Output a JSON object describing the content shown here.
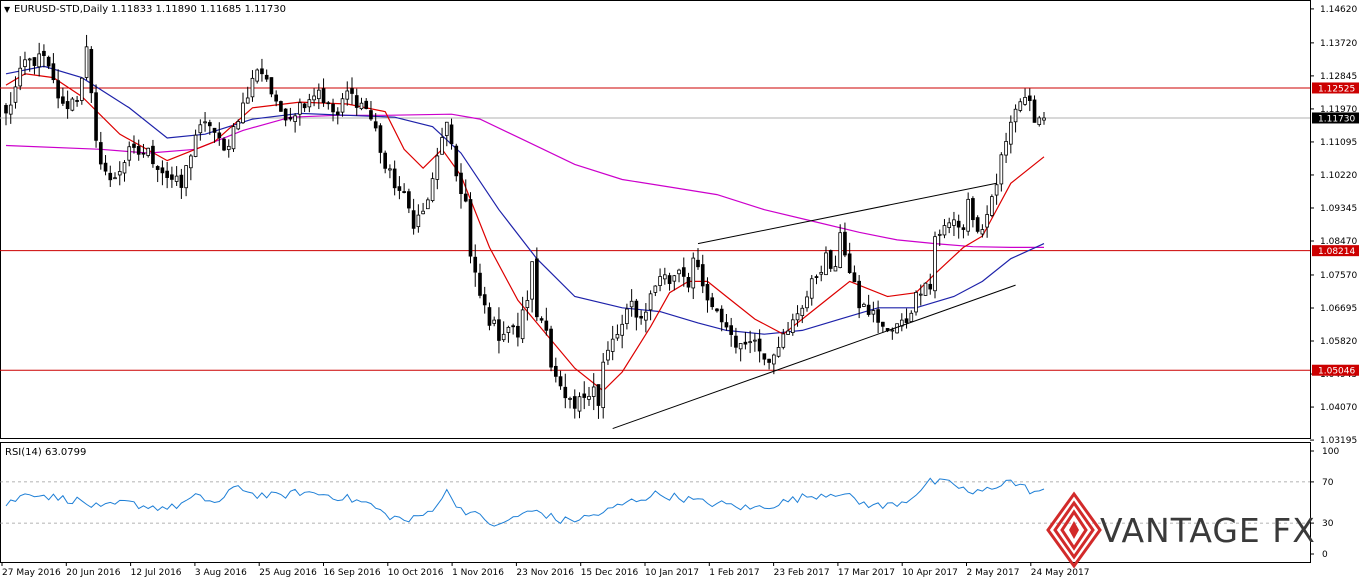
{
  "window": {
    "symbol_header": "EURUSD-STD,Daily",
    "ohlc": "1.11833 1.11890 1.11685 1.11730"
  },
  "rsi_header": "RSI(14) 63.0799",
  "brand": {
    "name": "VANTAGE FX"
  },
  "colors": {
    "candle": "#000000",
    "ema_fast": "#dd0000",
    "ema_mid": "#1e22aa",
    "ema_slow": "#cc00cc",
    "hline": "#cc0000",
    "rsi_line": "#1e7fd6",
    "current_price_box": "#000000",
    "level_box": "#cc0000"
  },
  "chart_data": {
    "type": "candlestick",
    "price_axis": {
      "ylim": [
        1.0325,
        1.1475
      ],
      "ticks": [
        "1.14620",
        "1.13720",
        "1.12845",
        "1.11970",
        "1.11095",
        "1.10220",
        "1.09345",
        "1.08470",
        "1.07570",
        "1.06695",
        "1.05820",
        "1.04945",
        "1.04070",
        "1.03195"
      ]
    },
    "current_price": "1.11730",
    "horizontal_levels": [
      {
        "value": 1.12525,
        "label": "1.12525"
      },
      {
        "value": 1.08214,
        "label": "1.08214"
      },
      {
        "value": 1.05046,
        "label": "1.05046"
      }
    ],
    "x_labels": [
      "27 May 2016",
      "20 Jun 2016",
      "12 Jul 2016",
      "3 Aug 2016",
      "25 Aug 2016",
      "16 Sep 2016",
      "10 Oct 2016",
      "1 Nov 2016",
      "23 Nov 2016",
      "15 Dec 2016",
      "10 Jan 2017",
      "1 Feb 2017",
      "23 Feb 2017",
      "17 Mar 2017",
      "10 Apr 2017",
      "2 May 2017",
      "24 May 2017"
    ],
    "close_path": [
      [
        0,
        1.118
      ],
      [
        4,
        1.132
      ],
      [
        8,
        1.133
      ],
      [
        12,
        1.12
      ],
      [
        15,
        1.123
      ],
      [
        17,
        1.135
      ],
      [
        19,
        1.11
      ],
      [
        22,
        1.1
      ],
      [
        26,
        1.108
      ],
      [
        30,
        1.108
      ],
      [
        34,
        1.102
      ],
      [
        37,
        1.099
      ],
      [
        40,
        1.113
      ],
      [
        43,
        1.116
      ],
      [
        46,
        1.108
      ],
      [
        49,
        1.118
      ],
      [
        51,
        1.123
      ],
      [
        53,
        1.131
      ],
      [
        55,
        1.128
      ],
      [
        57,
        1.12
      ],
      [
        60,
        1.118
      ],
      [
        63,
        1.122
      ],
      [
        66,
        1.125
      ],
      [
        68,
        1.12
      ],
      [
        70,
        1.118
      ],
      [
        72,
        1.124
      ],
      [
        74,
        1.122
      ],
      [
        76,
        1.12
      ],
      [
        78,
        1.114
      ],
      [
        80,
        1.104
      ],
      [
        82,
        1.1
      ],
      [
        84,
        1.096
      ],
      [
        86,
        1.09
      ],
      [
        88,
        1.092
      ],
      [
        90,
        1.1
      ],
      [
        92,
        1.113
      ],
      [
        93,
        1.115
      ],
      [
        95,
        1.102
      ],
      [
        97,
        1.095
      ],
      [
        98,
        1.08
      ],
      [
        100,
        1.07
      ],
      [
        102,
        1.064
      ],
      [
        104,
        1.06
      ],
      [
        106,
        1.062
      ],
      [
        108,
        1.06
      ],
      [
        110,
        1.07
      ],
      [
        111,
        1.078
      ],
      [
        112,
        1.065
      ],
      [
        114,
        1.063
      ],
      [
        115,
        1.052
      ],
      [
        116,
        1.048
      ],
      [
        118,
        1.042
      ],
      [
        120,
        1.04
      ],
      [
        122,
        1.044
      ],
      [
        124,
        1.047
      ],
      [
        125,
        1.041
      ],
      [
        126,
        1.052
      ],
      [
        128,
        1.058
      ],
      [
        130,
        1.062
      ],
      [
        132,
        1.068
      ],
      [
        134,
        1.064
      ],
      [
        136,
        1.07
      ],
      [
        138,
        1.076
      ],
      [
        140,
        1.074
      ],
      [
        142,
        1.078
      ],
      [
        144,
        1.074
      ],
      [
        145,
        1.08
      ],
      [
        147,
        1.072
      ],
      [
        149,
        1.066
      ],
      [
        151,
        1.064
      ],
      [
        153,
        1.06
      ],
      [
        155,
        1.056
      ],
      [
        157,
        1.06
      ],
      [
        159,
        1.056
      ],
      [
        161,
        1.054
      ],
      [
        163,
        1.058
      ],
      [
        165,
        1.06
      ],
      [
        167,
        1.066
      ],
      [
        169,
        1.07
      ],
      [
        171,
        1.076
      ],
      [
        173,
        1.08
      ],
      [
        175,
        1.076
      ],
      [
        176,
        1.088
      ],
      [
        178,
        1.076
      ],
      [
        180,
        1.068
      ],
      [
        182,
        1.066
      ],
      [
        184,
        1.064
      ],
      [
        186,
        1.06
      ],
      [
        188,
        1.062
      ],
      [
        190,
        1.064
      ],
      [
        192,
        1.07
      ],
      [
        194,
        1.075
      ],
      [
        195,
        1.072
      ],
      [
        196,
        1.086
      ],
      [
        198,
        1.088
      ],
      [
        200,
        1.09
      ],
      [
        202,
        1.088
      ],
      [
        203,
        1.096
      ],
      [
        204,
        1.09
      ],
      [
        206,
        1.086
      ],
      [
        207,
        1.09
      ],
      [
        208,
        1.096
      ],
      [
        209,
        1.1
      ],
      [
        210,
        1.106
      ],
      [
        212,
        1.118
      ],
      [
        214,
        1.122
      ],
      [
        216,
        1.12
      ],
      [
        217,
        1.118
      ],
      [
        219,
        1.1173
      ]
    ],
    "volatility": [
      [
        0,
        0.006
      ],
      [
        85,
        0.005
      ],
      [
        92,
        0.008
      ],
      [
        100,
        0.007
      ],
      [
        130,
        0.006
      ],
      [
        219,
        0.005
      ]
    ],
    "ema_fast": [
      [
        0,
        1.126
      ],
      [
        4,
        1.129
      ],
      [
        10,
        1.128
      ],
      [
        16,
        1.123
      ],
      [
        24,
        1.113
      ],
      [
        34,
        1.106
      ],
      [
        44,
        1.111
      ],
      [
        52,
        1.12
      ],
      [
        62,
        1.1215
      ],
      [
        72,
        1.121
      ],
      [
        80,
        1.119
      ],
      [
        84,
        1.109
      ],
      [
        88,
        1.104
      ],
      [
        92,
        1.109
      ],
      [
        96,
        1.102
      ],
      [
        102,
        1.083
      ],
      [
        108,
        1.069
      ],
      [
        114,
        1.06
      ],
      [
        120,
        1.051
      ],
      [
        126,
        1.045
      ],
      [
        130,
        1.05
      ],
      [
        136,
        1.062
      ],
      [
        140,
        1.071
      ],
      [
        144,
        1.074
      ],
      [
        148,
        1.074
      ],
      [
        152,
        1.07
      ],
      [
        158,
        1.064
      ],
      [
        164,
        1.06
      ],
      [
        168,
        1.064
      ],
      [
        174,
        1.07
      ],
      [
        178,
        1.074
      ],
      [
        186,
        1.07
      ],
      [
        192,
        1.071
      ],
      [
        196,
        1.076
      ],
      [
        202,
        1.083
      ],
      [
        206,
        1.086
      ],
      [
        212,
        1.1
      ],
      [
        219,
        1.107
      ]
    ],
    "ema_mid": [
      [
        0,
        1.129
      ],
      [
        8,
        1.131
      ],
      [
        16,
        1.128
      ],
      [
        26,
        1.12
      ],
      [
        34,
        1.112
      ],
      [
        42,
        1.113
      ],
      [
        52,
        1.117
      ],
      [
        62,
        1.1185
      ],
      [
        72,
        1.118
      ],
      [
        82,
        1.1175
      ],
      [
        90,
        1.115
      ],
      [
        96,
        1.108
      ],
      [
        104,
        1.093
      ],
      [
        112,
        1.08
      ],
      [
        120,
        1.07
      ],
      [
        130,
        1.067
      ],
      [
        138,
        1.066
      ],
      [
        146,
        1.063
      ],
      [
        152,
        1.061
      ],
      [
        160,
        1.06
      ],
      [
        168,
        1.061
      ],
      [
        176,
        1.064
      ],
      [
        184,
        1.067
      ],
      [
        192,
        1.067
      ],
      [
        200,
        1.07
      ],
      [
        206,
        1.074
      ],
      [
        212,
        1.08
      ],
      [
        219,
        1.084
      ]
    ],
    "ema_slow": [
      [
        0,
        1.11
      ],
      [
        20,
        1.109
      ],
      [
        30,
        1.108
      ],
      [
        40,
        1.109
      ],
      [
        50,
        1.114
      ],
      [
        60,
        1.1175
      ],
      [
        70,
        1.118
      ],
      [
        80,
        1.118
      ],
      [
        94,
        1.1183
      ],
      [
        100,
        1.117
      ],
      [
        110,
        1.111
      ],
      [
        120,
        1.105
      ],
      [
        130,
        1.101
      ],
      [
        140,
        1.099
      ],
      [
        150,
        1.097
      ],
      [
        160,
        1.093
      ],
      [
        170,
        1.09
      ],
      [
        180,
        1.087
      ],
      [
        188,
        1.085
      ],
      [
        196,
        1.084
      ],
      [
        204,
        1.0832
      ],
      [
        212,
        1.083
      ],
      [
        219,
        1.083
      ]
    ],
    "trendlines": [
      {
        "from": [
          128,
          1.035
        ],
        "to": [
          213,
          1.073
        ]
      },
      {
        "from": [
          146,
          1.084
        ],
        "to": [
          209,
          1.1
        ]
      }
    ],
    "rsi": {
      "ticks": [
        "100",
        "70",
        "30",
        "0"
      ],
      "levels": [
        30,
        70
      ],
      "ylim": [
        0,
        100
      ],
      "values": [
        [
          0,
          48
        ],
        [
          5,
          60
        ],
        [
          10,
          55
        ],
        [
          15,
          52
        ],
        [
          20,
          44
        ],
        [
          25,
          50
        ],
        [
          30,
          46
        ],
        [
          35,
          45
        ],
        [
          40,
          55
        ],
        [
          45,
          50
        ],
        [
          49,
          67
        ],
        [
          52,
          58
        ],
        [
          57,
          56
        ],
        [
          62,
          60
        ],
        [
          67,
          58
        ],
        [
          72,
          54
        ],
        [
          77,
          48
        ],
        [
          80,
          38
        ],
        [
          85,
          32
        ],
        [
          89,
          40
        ],
        [
          93,
          60
        ],
        [
          96,
          44
        ],
        [
          100,
          36
        ],
        [
          104,
          26
        ],
        [
          107,
          36
        ],
        [
          112,
          42
        ],
        [
          117,
          32
        ],
        [
          121,
          34
        ],
        [
          126,
          40
        ],
        [
          131,
          50
        ],
        [
          137,
          58
        ],
        [
          142,
          55
        ],
        [
          147,
          50
        ],
        [
          152,
          48
        ],
        [
          157,
          44
        ],
        [
          162,
          48
        ],
        [
          168,
          55
        ],
        [
          172,
          58
        ],
        [
          176,
          60
        ],
        [
          180,
          50
        ],
        [
          185,
          46
        ],
        [
          190,
          52
        ],
        [
          195,
          70
        ],
        [
          200,
          68
        ],
        [
          204,
          58
        ],
        [
          208,
          64
        ],
        [
          211,
          72
        ],
        [
          214,
          66
        ],
        [
          217,
          60
        ],
        [
          219,
          63.08
        ]
      ]
    },
    "n_bars": 220
  }
}
